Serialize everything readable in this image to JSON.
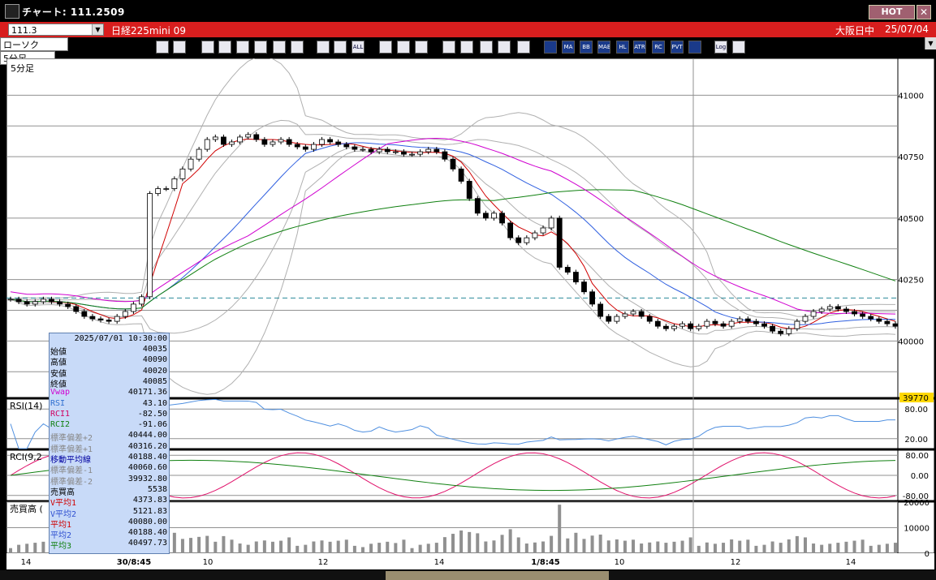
{
  "window": {
    "title": "チャート: 111.2509",
    "hot_label": "HOT",
    "close_label": "✕"
  },
  "instrument_bar": {
    "code": "111.3",
    "interval": "5分足",
    "chart_type": "ローソク",
    "instrument_name": "日経225mini 09",
    "session": "大阪日中",
    "date": "25/07/04"
  },
  "toolbar": {
    "icons": [
      "zoom-icon",
      "window-icon",
      "draw-line-icon",
      "pen-icon",
      "cursor-icon",
      "undo-icon",
      "notes-icon",
      "trash-icon",
      "candle-icon",
      "candle-alt-icon",
      "all-icon",
      "settings-icon",
      "brush-icon",
      "color-icon",
      "download-icon",
      "search-chart-icon",
      "table-icon",
      "compare-icon",
      "info-icon",
      "ma-grid-icon",
      "ma-icon",
      "bb-icon",
      "mae-icon",
      "hl-icon",
      "atr-icon",
      "rc-icon",
      "pvt-icon",
      "frame-icon",
      "log-icon",
      "export-icon"
    ],
    "labels": {
      "all": "ALL",
      "ma": "MA",
      "bb": "BB",
      "mae": "MAE",
      "hl": "HL",
      "atr": "ATR",
      "rc": "RC",
      "pvt": "PVT",
      "log": "Log"
    }
  },
  "main_panel": {
    "label": "5分足",
    "price_ticks": [
      "41000",
      "40750",
      "40500",
      "40250",
      "40000"
    ],
    "current_price": "39770"
  },
  "rsi_panel": {
    "label": "RSI(14)",
    "ticks": [
      "80.00",
      "20.00"
    ]
  },
  "rci_panel": {
    "label": "RCI(9,2",
    "ticks": [
      "80.00",
      "0.00",
      "-80.00"
    ]
  },
  "volume_panel": {
    "label": "売買高 (",
    "ticks": [
      "20000",
      "10000",
      "0"
    ]
  },
  "x_axis": {
    "labels": [
      "14",
      "30/8:45",
      "10",
      "12",
      "14",
      "1/8:45",
      "10",
      "12",
      "14"
    ]
  },
  "datatip": {
    "header": "2025/07/01  10:30:00",
    "rows": [
      {
        "k": "始値",
        "v": "40035",
        "c": "#000"
      },
      {
        "k": "高値",
        "v": "40090",
        "c": "#000"
      },
      {
        "k": "安値",
        "v": "40020",
        "c": "#000"
      },
      {
        "k": "終値",
        "v": "40085",
        "c": "#000"
      },
      {
        "k": "Vwap",
        "v": "40171.36",
        "c": "#d000d0"
      },
      {
        "k": "RSI",
        "v": "43.10",
        "c": "#3070d0"
      },
      {
        "k": "RCI1",
        "v": "-82.50",
        "c": "#d00060"
      },
      {
        "k": "RCI2",
        "v": "-91.06",
        "c": "#108010"
      },
      {
        "k": "標準偏差+2",
        "v": "40444.00",
        "c": "#888"
      },
      {
        "k": "標準偏差+1",
        "v": "40316.20",
        "c": "#888"
      },
      {
        "k": "移動平均線",
        "v": "40188.40",
        "c": "#0000a0"
      },
      {
        "k": "標準偏差-1",
        "v": "40060.60",
        "c": "#888"
      },
      {
        "k": "標準偏差-2",
        "v": "39932.80",
        "c": "#888"
      },
      {
        "k": "売買高",
        "v": "5538",
        "c": "#000"
      },
      {
        "k": "V平均1",
        "v": "4373.83",
        "c": "#d00000"
      },
      {
        "k": "V平均2",
        "v": "5121.83",
        "c": "#3050d0"
      },
      {
        "k": "平均1",
        "v": "40080.00",
        "c": "#d00000"
      },
      {
        "k": "平均2",
        "v": "40188.40",
        "c": "#3050d0"
      },
      {
        "k": "平均3",
        "v": "40497.73",
        "c": "#108010"
      }
    ]
  },
  "colors": {
    "background": "#ffffff",
    "frame": "#000000",
    "grid": "#909090",
    "ma1": "#d00000",
    "ma2": "#3060e0",
    "ma3": "#108010",
    "vwap": "#d000d0",
    "band": "#b0b0b0",
    "rsi": "#5090e0",
    "rci1": "#e0106a",
    "rci2": "#108010",
    "volume": "#909090"
  },
  "chart_data": {
    "type": "candlestick",
    "y_range": [
      39770,
      41150
    ],
    "close": [
      40170,
      40160,
      40150,
      40160,
      40170,
      40160,
      40150,
      40140,
      40120,
      40100,
      40090,
      40085,
      40080,
      40100,
      40120,
      40150,
      40180,
      40600,
      40620,
      40620,
      40660,
      40700,
      40740,
      40780,
      40820,
      40830,
      40800,
      40810,
      40830,
      40840,
      40820,
      40800,
      40810,
      40820,
      40800,
      40790,
      40780,
      40800,
      40820,
      40810,
      40800,
      40790,
      40780,
      40780,
      40770,
      40780,
      40770,
      40770,
      40760,
      40760,
      40770,
      40780,
      40770,
      40740,
      40700,
      40650,
      40580,
      40520,
      40500,
      40520,
      40480,
      40420,
      40400,
      40420,
      40440,
      40460,
      40500,
      40300,
      40280,
      40240,
      40200,
      40150,
      40100,
      40080,
      40100,
      40110,
      40120,
      40100,
      40080,
      40060,
      40050,
      40060,
      40070,
      40050,
      40060,
      40080,
      40070,
      40060,
      40080,
      40090,
      40080,
      40070,
      40060,
      40040,
      40030,
      40050,
      40080,
      40100,
      40120,
      40130,
      40140,
      40130,
      40120,
      40110,
      40100,
      40090,
      40080,
      40070,
      40060
    ]
  }
}
